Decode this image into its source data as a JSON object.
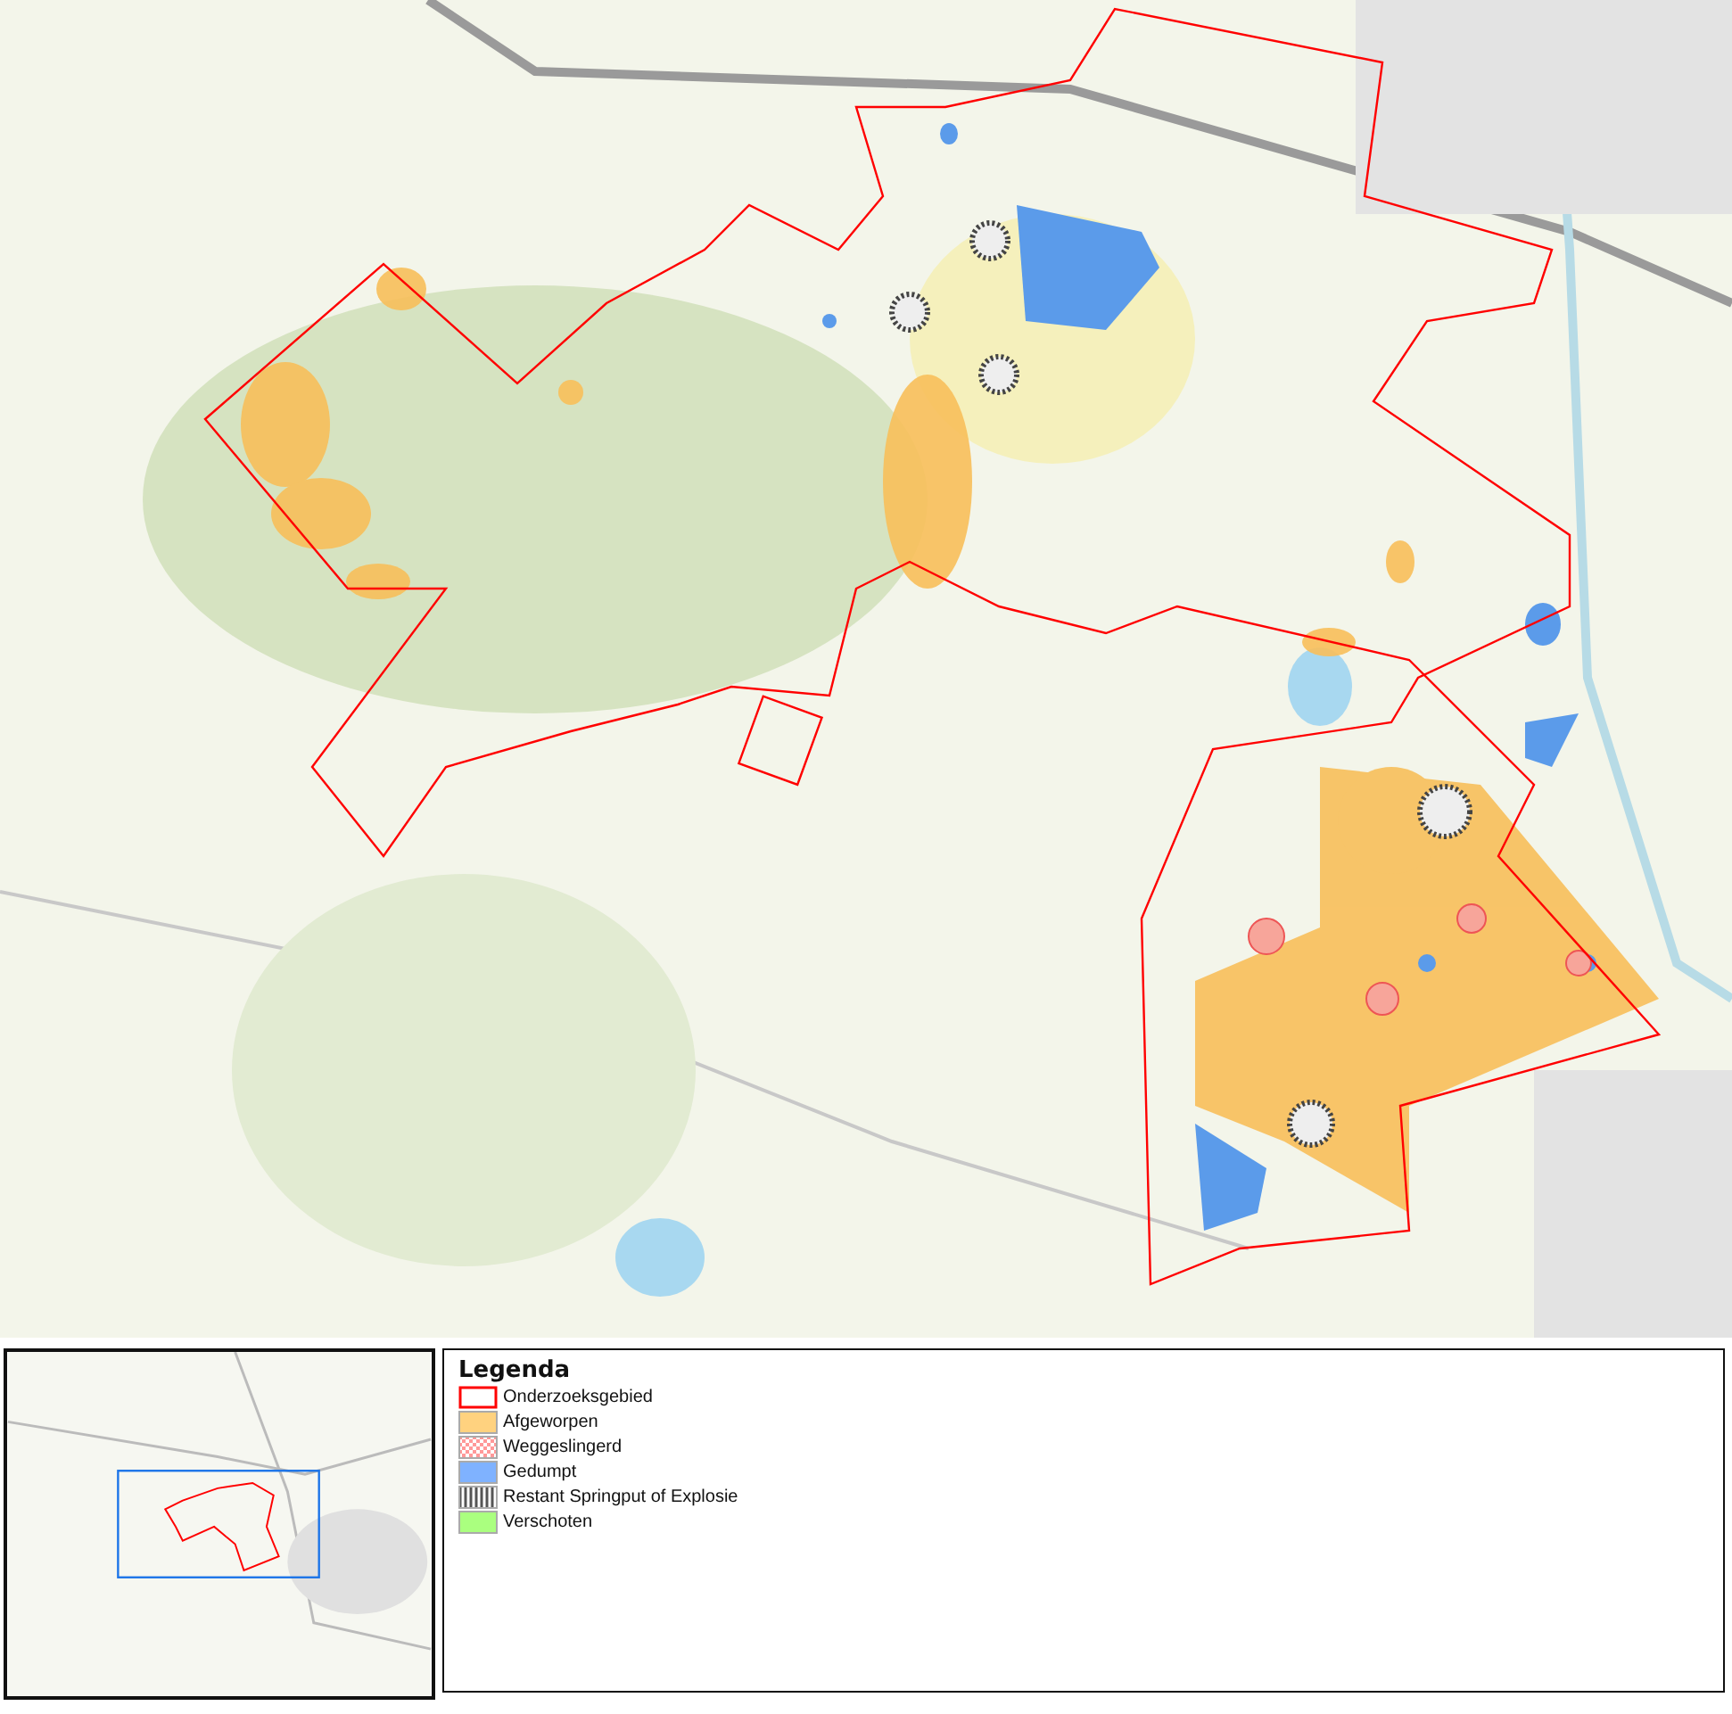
{
  "legend": {
    "title": "Legenda",
    "items": [
      {
        "label": "Onderzoeksgebied",
        "kind": "outline",
        "color": "#ff0000"
      },
      {
        "label": "Afgeworpen",
        "kind": "fill",
        "color": "#ffd27f"
      },
      {
        "label": "Weggeslingerd",
        "kind": "hatch",
        "color": "#ff9999"
      },
      {
        "label": "Gedumpt",
        "kind": "fill",
        "color": "#7fb2ff"
      },
      {
        "label": "Restant Springput of Explosie",
        "kind": "stripes",
        "color": "#555555"
      },
      {
        "label": "Verschoten",
        "kind": "fill",
        "color": "#aaff7f"
      }
    ]
  }
}
